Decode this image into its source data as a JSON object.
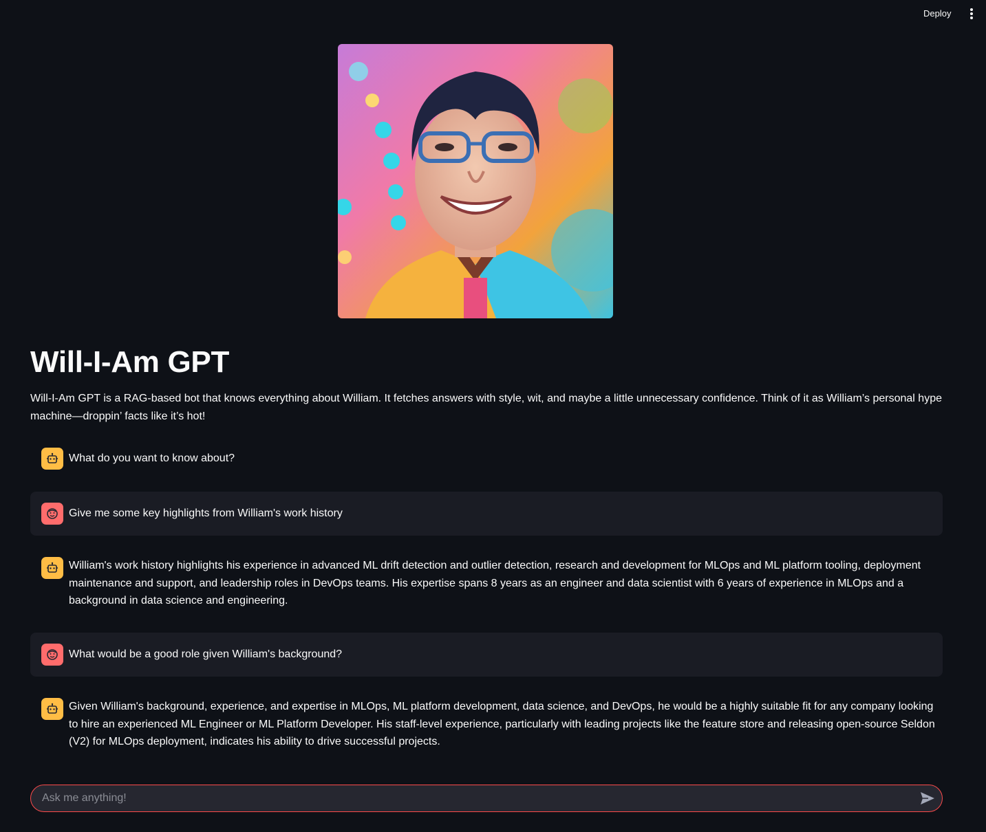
{
  "header": {
    "deploy_label": "Deploy",
    "menu_icon": "kebab-menu-icon"
  },
  "hero_image": {
    "alt": "Colorful painted portrait of a smiling man with glasses"
  },
  "page": {
    "title": "Will-I-Am GPT",
    "description": "Will-I-Am GPT is a RAG-based bot that knows everything about William. It fetches answers with style, wit, and maybe a little unnecessary confidence. Think of it as William’s personal hype machine—droppin’ facts like it’s hot!"
  },
  "messages": [
    {
      "role": "assistant",
      "avatar_icon": "robot-icon",
      "text": "What do you want to know about?"
    },
    {
      "role": "user",
      "avatar_icon": "face-icon",
      "text": "Give me some key highlights from William's work history"
    },
    {
      "role": "assistant",
      "avatar_icon": "robot-icon",
      "text": "William's work history highlights his experience in advanced ML drift detection and outlier detection, research and development for MLOps and ML platform tooling, deployment maintenance and support, and leadership roles in DevOps teams. His expertise spans 8 years as an engineer and data scientist with 6 years of experience in MLOps and a background in data science and engineering."
    },
    {
      "role": "user",
      "avatar_icon": "face-icon",
      "text": "What would be a good role given William's background?"
    },
    {
      "role": "assistant",
      "avatar_icon": "robot-icon",
      "text": "Given William's background, experience, and expertise in MLOps, ML platform development, data science, and DevOps, he would be a highly suitable fit for any company looking to hire an experienced ML Engineer or ML Platform Developer. His staff-level experience, particularly with leading projects like the feature store and releasing open-source Seldon (V2) for MLOps deployment, indicates his ability to drive successful projects."
    }
  ],
  "chat_input": {
    "placeholder": "Ask me anything!",
    "value": "",
    "send_icon": "send-icon"
  },
  "colors": {
    "background": "#0e1117",
    "user_message_bg": "#1a1c24",
    "assistant_avatar": "#ffbd45",
    "user_avatar": "#ff6c6c",
    "input_border": "#ff4b4b"
  }
}
